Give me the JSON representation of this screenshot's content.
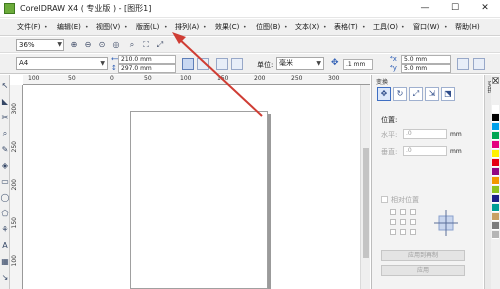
{
  "window": {
    "title": "CorelDRAW X4 ( 专业版 ) - [图形1]",
    "minimize": "—",
    "restore": "☐",
    "close": "✕"
  },
  "menu": [
    {
      "label": "文件(F)"
    },
    {
      "label": "编辑(E)"
    },
    {
      "label": "视图(V)"
    },
    {
      "label": "版面(L)"
    },
    {
      "label": "排列(A)"
    },
    {
      "label": "效果(C)"
    },
    {
      "label": "位图(B)"
    },
    {
      "label": "文本(X)"
    },
    {
      "label": "表格(T)"
    },
    {
      "label": "工具(O)"
    },
    {
      "label": "窗口(W)"
    },
    {
      "label": "帮助(H)"
    }
  ],
  "toolbar": {
    "zoom_value": "36%"
  },
  "property_bar": {
    "paper_size": "A4",
    "width": "210.0 mm",
    "height": "297.0 mm",
    "units_label": "单位:",
    "units_value": "毫米",
    "nudge": ".1 mm",
    "dup_x": "5.0 mm",
    "dup_y": "5.0 mm"
  },
  "rulers": {
    "horizontal_ticks": [
      "100",
      "50",
      "0",
      "50",
      "100",
      "150",
      "200",
      "250",
      "300"
    ],
    "vertical_ticks": [
      "300",
      "250",
      "200",
      "150",
      "100"
    ]
  },
  "docker": {
    "title": "变换",
    "side_tab": "变换",
    "position_heading": "位置:",
    "x_label": "水平:",
    "x_value": ".0",
    "y_label": "垂直:",
    "y_value": ".0",
    "unit": "mm",
    "relative_label": "相对位置",
    "apply_copy_button": "应用到再制",
    "apply_button": "应用"
  },
  "colors": {
    "palette": [
      "#ffffff",
      "#000000",
      "#00a0e9",
      "#00a651",
      "#e4007f",
      "#fff100",
      "#e60012",
      "#920783",
      "#f39800",
      "#8fc31f",
      "#1d2088",
      "#009e96",
      "#c9a063",
      "#7d7d7d",
      "#b5b5b5"
    ],
    "arrow": "#cf3d34",
    "app_icon": "#6cab3b"
  }
}
